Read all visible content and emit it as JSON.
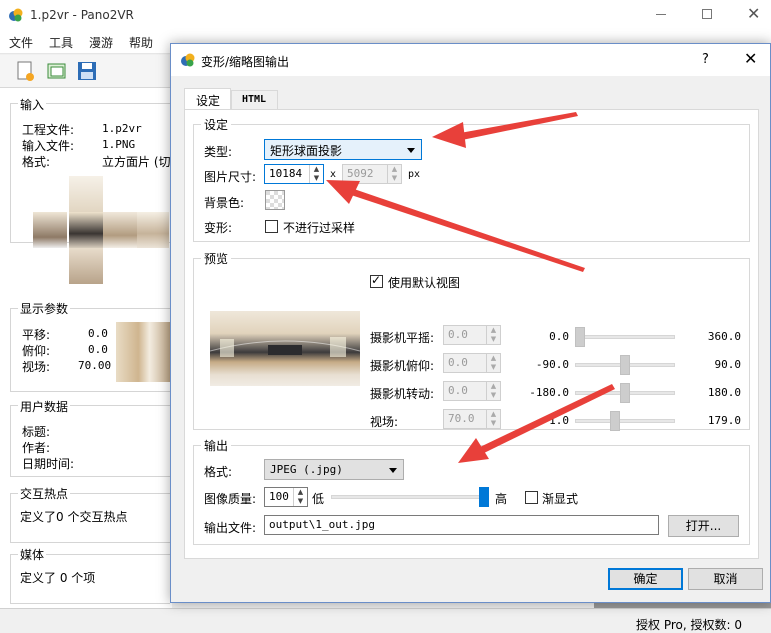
{
  "main": {
    "title": "1.p2vr  - Pano2VR",
    "menu": [
      "文件",
      "工具",
      "漫游",
      "帮助"
    ],
    "input": {
      "title": "输入",
      "project_label": "工程文件:",
      "project_value": "1.p2vr",
      "input_label": "输入文件:",
      "input_value": "1.PNG",
      "format_label": "格式:",
      "format_value": "立方面片 (切"
    },
    "display": {
      "title": "显示参数",
      "pan_label": "平移:",
      "pan_value": "0.0",
      "tilt_label": "俯仰:",
      "tilt_value": "0.0",
      "fov_label": "视场:",
      "fov_value": "70.00"
    },
    "userdata": {
      "title": "用户数据",
      "title_label": "标题:",
      "author_label": "作者:",
      "date_label": "日期时间:"
    },
    "hotspots": {
      "title": "交互热点",
      "text": "定义了0 个交互热点"
    },
    "media": {
      "title": "媒体",
      "text": "定义了 0 个项"
    },
    "status": "授权 Pro, 授权数: 0"
  },
  "dialog": {
    "title": "变形/缩略图输出",
    "help": "?",
    "tabs": [
      "设定",
      "HTML"
    ],
    "settings": {
      "title": "设定",
      "type_label": "类型:",
      "type_value": "矩形球面投影",
      "size_label": "图片尺寸:",
      "width": "10184",
      "x": "x",
      "height": "5092",
      "unit": "px",
      "bg_label": "背景色:",
      "transform_label": "变形:",
      "no_resample": "不进行过采样"
    },
    "preview": {
      "title": "预览",
      "use_default": "使用默认视图",
      "rows": [
        {
          "label": "摄影机平摇:",
          "value": "0.0",
          "min": "0.0",
          "max": "360.0",
          "pos": 0.0
        },
        {
          "label": "摄影机俯仰:",
          "value": "0.0",
          "min": "-90.0",
          "max": "90.0",
          "pos": 0.5
        },
        {
          "label": "摄影机转动:",
          "value": "0.0",
          "min": "-180.0",
          "max": "180.0",
          "pos": 0.5
        },
        {
          "label": "视场:",
          "value": "70.0",
          "min": "1.0",
          "max": "179.0",
          "pos": 0.39
        }
      ]
    },
    "output": {
      "title": "输出",
      "format_label": "格式:",
      "format_value": "JPEG (.jpg)",
      "quality_label": "图像质量:",
      "quality_value": "100",
      "low": "低",
      "high": "高",
      "quality_pos": 1.0,
      "progressive": "渐显式",
      "file_label": "输出文件:",
      "file_value": "output\\1_out.jpg",
      "open": "打开..."
    },
    "ok": "确定",
    "cancel": "取消"
  },
  "colors": {
    "accent": "#0078d7",
    "arrow": "#e8403a"
  }
}
